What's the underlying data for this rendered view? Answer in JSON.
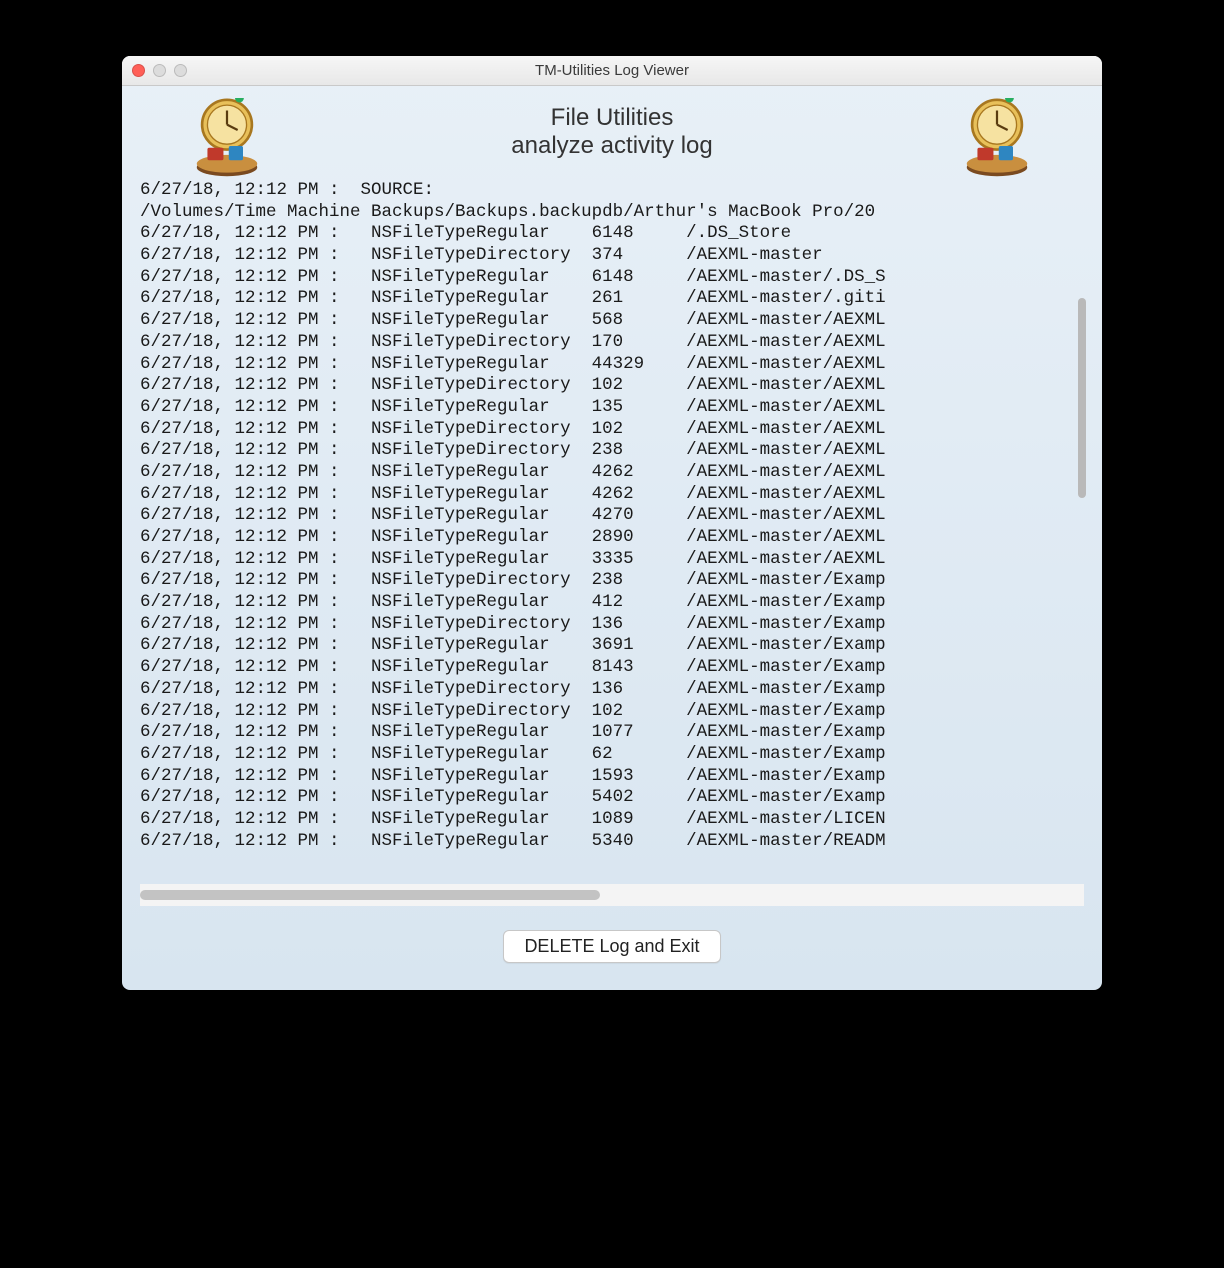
{
  "window": {
    "title": "TM-Utilities Log Viewer"
  },
  "header": {
    "main": "File Utilities",
    "sub": "analyze activity log",
    "icon_name": "time-machine-clock-icon"
  },
  "footer": {
    "delete_label": "DELETE Log and Exit"
  },
  "log": {
    "source_prefix": "6/27/18, 12:12 PM :  SOURCE:",
    "source_path": "/Volumes/Time Machine Backups/Backups.backupdb/Arthur's MacBook Pro/20",
    "entries": [
      {
        "ts": "6/27/18, 12:12 PM",
        "type": "NSFileTypeRegular",
        "size": "6148",
        "path": "/.DS_Store"
      },
      {
        "ts": "6/27/18, 12:12 PM",
        "type": "NSFileTypeDirectory",
        "size": "374",
        "path": "/AEXML-master"
      },
      {
        "ts": "6/27/18, 12:12 PM",
        "type": "NSFileTypeRegular",
        "size": "6148",
        "path": "/AEXML-master/.DS_S"
      },
      {
        "ts": "6/27/18, 12:12 PM",
        "type": "NSFileTypeRegular",
        "size": "261",
        "path": "/AEXML-master/.giti"
      },
      {
        "ts": "6/27/18, 12:12 PM",
        "type": "NSFileTypeRegular",
        "size": "568",
        "path": "/AEXML-master/AEXML"
      },
      {
        "ts": "6/27/18, 12:12 PM",
        "type": "NSFileTypeDirectory",
        "size": "170",
        "path": "/AEXML-master/AEXML"
      },
      {
        "ts": "6/27/18, 12:12 PM",
        "type": "NSFileTypeRegular",
        "size": "44329",
        "path": "/AEXML-master/AEXML"
      },
      {
        "ts": "6/27/18, 12:12 PM",
        "type": "NSFileTypeDirectory",
        "size": "102",
        "path": "/AEXML-master/AEXML"
      },
      {
        "ts": "6/27/18, 12:12 PM",
        "type": "NSFileTypeRegular",
        "size": "135",
        "path": "/AEXML-master/AEXML"
      },
      {
        "ts": "6/27/18, 12:12 PM",
        "type": "NSFileTypeDirectory",
        "size": "102",
        "path": "/AEXML-master/AEXML"
      },
      {
        "ts": "6/27/18, 12:12 PM",
        "type": "NSFileTypeDirectory",
        "size": "238",
        "path": "/AEXML-master/AEXML"
      },
      {
        "ts": "6/27/18, 12:12 PM",
        "type": "NSFileTypeRegular",
        "size": "4262",
        "path": "/AEXML-master/AEXML"
      },
      {
        "ts": "6/27/18, 12:12 PM",
        "type": "NSFileTypeRegular",
        "size": "4262",
        "path": "/AEXML-master/AEXML"
      },
      {
        "ts": "6/27/18, 12:12 PM",
        "type": "NSFileTypeRegular",
        "size": "4270",
        "path": "/AEXML-master/AEXML"
      },
      {
        "ts": "6/27/18, 12:12 PM",
        "type": "NSFileTypeRegular",
        "size": "2890",
        "path": "/AEXML-master/AEXML"
      },
      {
        "ts": "6/27/18, 12:12 PM",
        "type": "NSFileTypeRegular",
        "size": "3335",
        "path": "/AEXML-master/AEXML"
      },
      {
        "ts": "6/27/18, 12:12 PM",
        "type": "NSFileTypeDirectory",
        "size": "238",
        "path": "/AEXML-master/Examp"
      },
      {
        "ts": "6/27/18, 12:12 PM",
        "type": "NSFileTypeRegular",
        "size": "412",
        "path": "/AEXML-master/Examp"
      },
      {
        "ts": "6/27/18, 12:12 PM",
        "type": "NSFileTypeDirectory",
        "size": "136",
        "path": "/AEXML-master/Examp"
      },
      {
        "ts": "6/27/18, 12:12 PM",
        "type": "NSFileTypeRegular",
        "size": "3691",
        "path": "/AEXML-master/Examp"
      },
      {
        "ts": "6/27/18, 12:12 PM",
        "type": "NSFileTypeRegular",
        "size": "8143",
        "path": "/AEXML-master/Examp"
      },
      {
        "ts": "6/27/18, 12:12 PM",
        "type": "NSFileTypeDirectory",
        "size": "136",
        "path": "/AEXML-master/Examp"
      },
      {
        "ts": "6/27/18, 12:12 PM",
        "type": "NSFileTypeDirectory",
        "size": "102",
        "path": "/AEXML-master/Examp"
      },
      {
        "ts": "6/27/18, 12:12 PM",
        "type": "NSFileTypeRegular",
        "size": "1077",
        "path": "/AEXML-master/Examp"
      },
      {
        "ts": "6/27/18, 12:12 PM",
        "type": "NSFileTypeRegular",
        "size": "62",
        "path": "/AEXML-master/Examp"
      },
      {
        "ts": "6/27/18, 12:12 PM",
        "type": "NSFileTypeRegular",
        "size": "1593",
        "path": "/AEXML-master/Examp"
      },
      {
        "ts": "6/27/18, 12:12 PM",
        "type": "NSFileTypeRegular",
        "size": "5402",
        "path": "/AEXML-master/Examp"
      },
      {
        "ts": "6/27/18, 12:12 PM",
        "type": "NSFileTypeRegular",
        "size": "1089",
        "path": "/AEXML-master/LICEN"
      },
      {
        "ts": "6/27/18, 12:12 PM",
        "type": "NSFileTypeRegular",
        "size": "5340",
        "path": "/AEXML-master/READM"
      }
    ]
  }
}
